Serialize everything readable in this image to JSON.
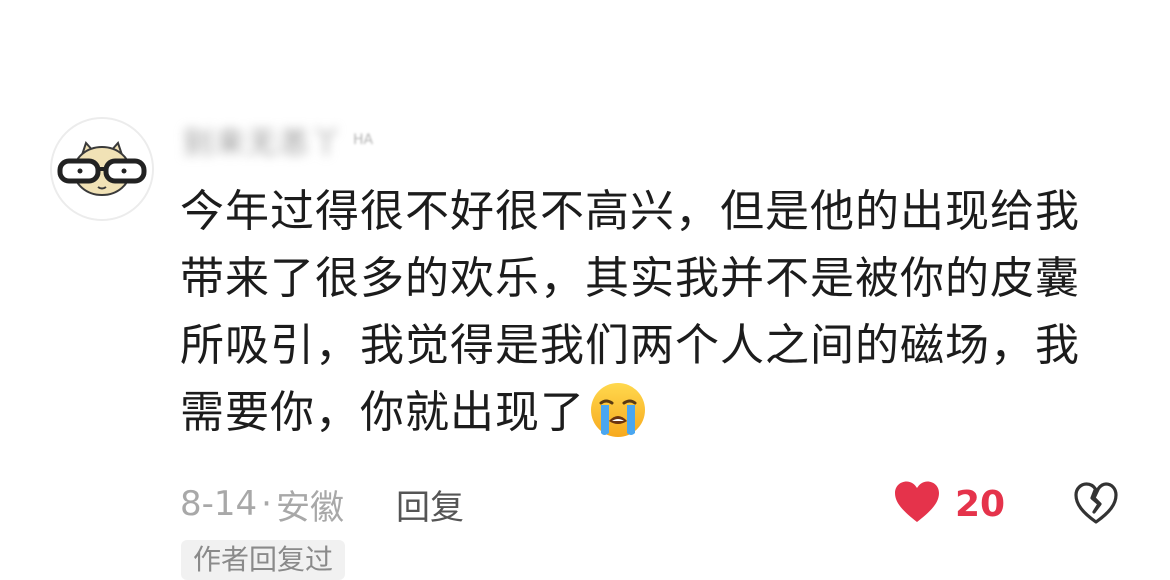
{
  "comment": {
    "username": "别来无恙丫",
    "username_suffix": "HA",
    "text": "今年过得很不好很不高兴，但是他的出现给我带来了很多的欢乐，其实我并不是被你的皮囊所吸引，我觉得是我们两个人之间的磁场，我需要你，你就出现了",
    "emoji": "loudly-crying-face-icon",
    "date": "8-14",
    "separator": "·",
    "location": "安徽",
    "reply_label": "回复",
    "like_count": "20",
    "author_reply_tag": "作者回复过"
  },
  "colors": {
    "like": "#e5334b",
    "meta": "#a8a8a8",
    "text": "#1c1c1c"
  }
}
